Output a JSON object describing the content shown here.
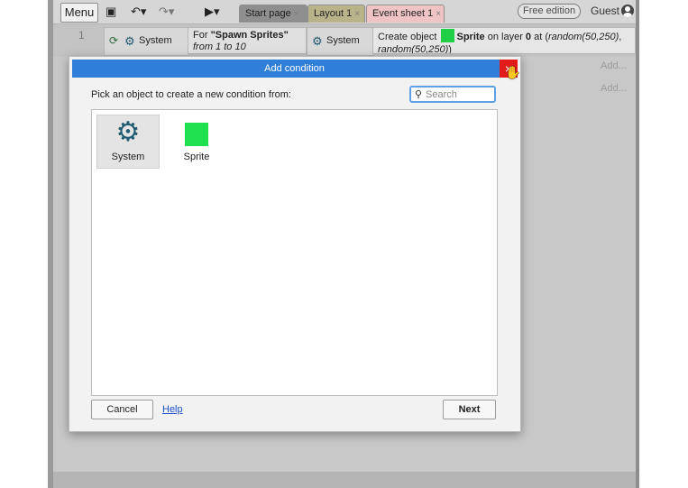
{
  "toolbar": {
    "menu_label": "Menu",
    "icons": {
      "save": "save-icon",
      "undo": "undo-icon",
      "redo": "redo-icon",
      "play": "play-icon"
    },
    "tabs": [
      {
        "label": "Start page",
        "close": "×"
      },
      {
        "label": "Layout 1",
        "close": "×"
      },
      {
        "label": "Event sheet 1",
        "close": "×"
      }
    ],
    "edition_badge": "Free edition",
    "user_label": "Guest"
  },
  "event_sheet": {
    "row_number": "1",
    "condition_object": "System",
    "for_prefix": "For ",
    "for_name": "\"Spawn Sprites\"",
    "for_range": "from 1 to 10",
    "action_object": "System",
    "action_create_prefix": "Create object ",
    "action_sprite": "Sprite",
    "action_layer_text": " on layer ",
    "action_layer": "0",
    "action_at": " at (",
    "action_expr1": "random(50,250)",
    "action_expr2": "random(50,250)",
    "action_close": ")",
    "action_comma": ",",
    "add_label": "Add..."
  },
  "dialog": {
    "title": "Add condition",
    "close_glyph": "×",
    "prompt": "Pick an object to create a new condition from:",
    "search": {
      "placeholder": "Search",
      "value": ""
    },
    "objects": [
      {
        "label": "System",
        "icon": "gear-icon"
      },
      {
        "label": "Sprite",
        "icon": "sprite-icon"
      }
    ],
    "cancel_label": "Cancel",
    "help_label": "Help",
    "next_label": "Next"
  },
  "colors": {
    "title_bar": "#2f7ed8",
    "close_button": "#e41b1b",
    "sprite_green": "#1fe04f",
    "system_gear": "#1f5a72"
  }
}
